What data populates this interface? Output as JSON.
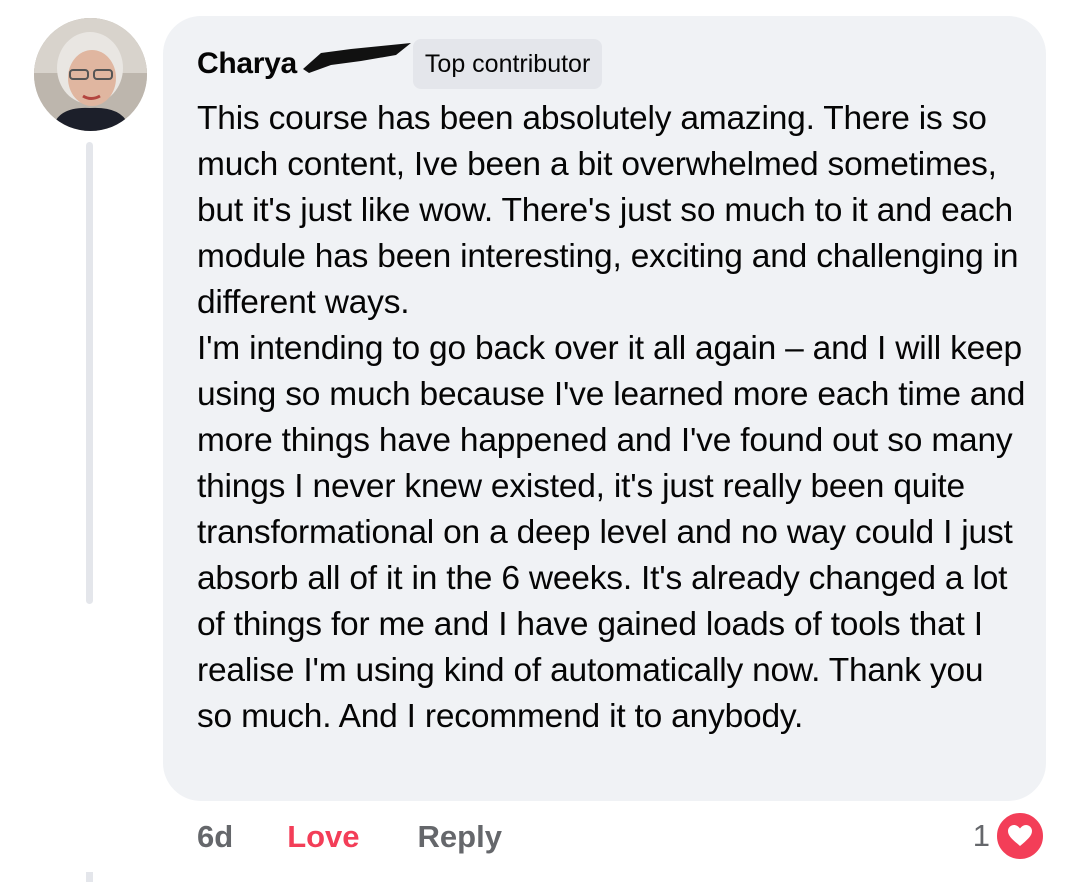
{
  "comment": {
    "author_name": "Charya",
    "badge": "Top contributor",
    "text": "This course has been absolutely amazing. There is so much content, Ive been a bit overwhelmed sometimes, but it's just like wow. There's just so much to it and each module has been interesting, exciting and challenging in different ways.\nI'm intending to go back over it all again – and I will keep using so much  because I've learned more each time and more things have happened and I've found out so many things I never knew existed, it's just really been quite transformational on a deep level and no way could I just absorb all of it in the 6 weeks.  It's already changed a lot of things for me and I have gained loads of tools that I realise I'm using kind of automatically now. Thank you so much. And I recommend it to anybody.",
    "timestamp": "6d",
    "reaction_count": "1"
  },
  "actions": {
    "love_label": "Love",
    "reply_label": "Reply"
  },
  "icons": {
    "reaction": "heart-icon",
    "avatar": "avatar"
  },
  "colors": {
    "bubble": "#f0f2f5",
    "love": "#f33e58",
    "muted": "#65676b",
    "badge": "#e4e6eb"
  }
}
